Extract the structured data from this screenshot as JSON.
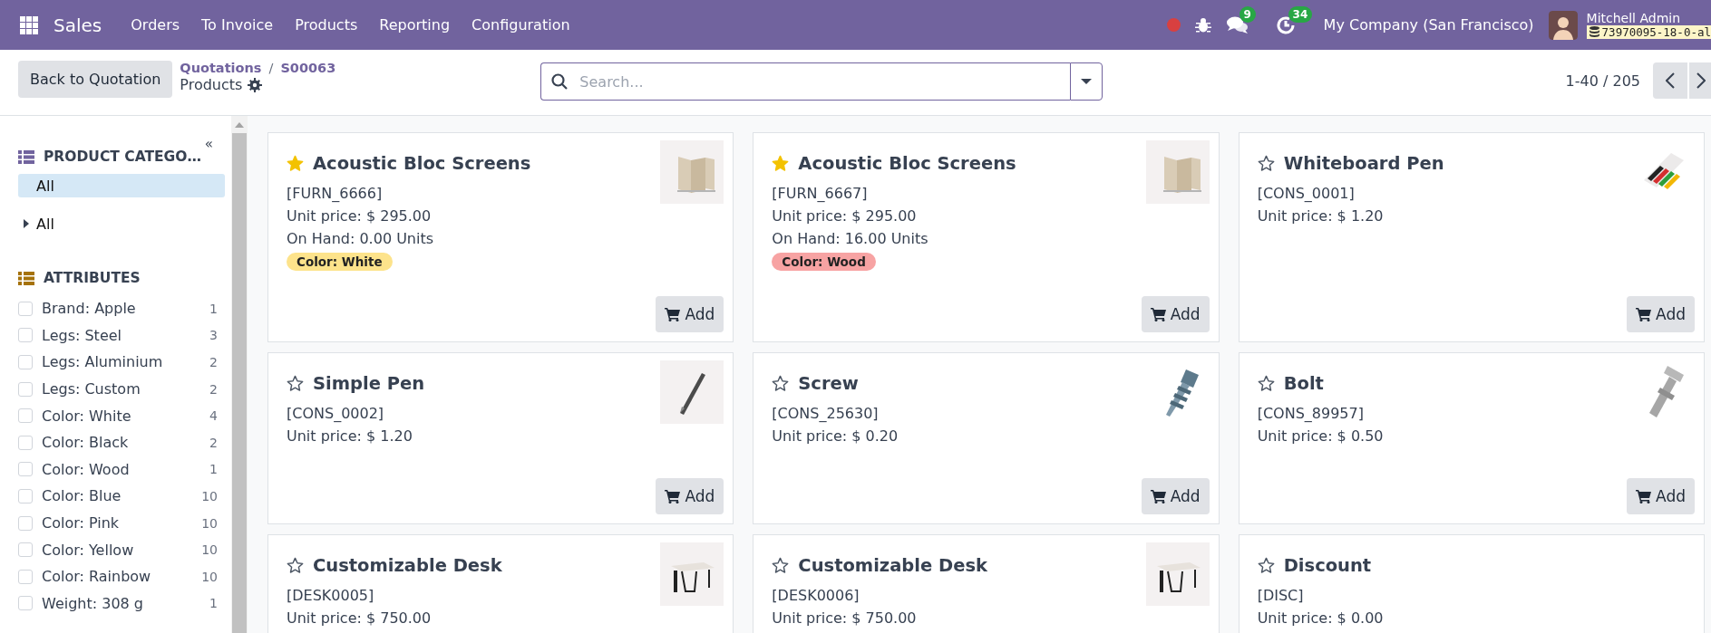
{
  "navbar": {
    "app": "Sales",
    "menu": [
      "Orders",
      "To Invoice",
      "Products",
      "Reporting",
      "Configuration"
    ],
    "chat_count": "9",
    "activity_count": "34",
    "company": "My Company (San Francisco)",
    "user": "Mitchell Admin",
    "database": "73970095-18-0-al"
  },
  "control_panel": {
    "back_button": "Back to Quotation",
    "breadcrumbs": [
      "Quotations",
      "S00063"
    ],
    "breadcrumb_separator": "/",
    "current": "Products",
    "search": {
      "placeholder": "Search..."
    },
    "pager": "1-40 / 205"
  },
  "sidebar": {
    "categories_title": "PRODUCT CATEGO…",
    "collapse": "«",
    "categories": [
      {
        "label": "All",
        "selected": true
      },
      {
        "label": "All",
        "selected": false,
        "expanded": false
      }
    ],
    "attributes_title": "ATTRIBUTES",
    "attributes": [
      {
        "label": "Brand: Apple",
        "count": "1",
        "checked": false
      },
      {
        "label": "Legs: Steel",
        "count": "3",
        "checked": false
      },
      {
        "label": "Legs: Aluminium",
        "count": "2",
        "checked": false
      },
      {
        "label": "Legs: Custom",
        "count": "2",
        "checked": false
      },
      {
        "label": "Color: White",
        "count": "4",
        "checked": false
      },
      {
        "label": "Color: Black",
        "count": "2",
        "checked": false
      },
      {
        "label": "Color: Wood",
        "count": "1",
        "checked": false
      },
      {
        "label": "Color: Blue",
        "count": "10",
        "checked": false
      },
      {
        "label": "Color: Pink",
        "count": "10",
        "checked": false
      },
      {
        "label": "Color: Yellow",
        "count": "10",
        "checked": false
      },
      {
        "label": "Color: Rainbow",
        "count": "10",
        "checked": false
      },
      {
        "label": "Weight: 308 g",
        "count": "1",
        "checked": false
      }
    ]
  },
  "products": [
    {
      "name": "Acoustic Bloc Screens",
      "favorite": true,
      "code": "[FURN_6666]",
      "price": "Unit price: $ 295.00",
      "on_hand": "On Hand: 0.00 Units",
      "tag": {
        "label": "Color: White",
        "color": "#fde38b"
      },
      "button": "Add"
    },
    {
      "name": "Acoustic Bloc Screens",
      "favorite": true,
      "code": "[FURN_6667]",
      "price": "Unit price: $ 295.00",
      "on_hand": "On Hand: 16.00 Units",
      "tag": {
        "label": "Color: Wood",
        "color": "#f7a3a3"
      },
      "button": "Add"
    },
    {
      "name": "Whiteboard Pen",
      "favorite": false,
      "code": "[CONS_0001]",
      "price": "Unit price: $ 1.20",
      "button": "Add"
    },
    {
      "name": "Simple Pen",
      "favorite": false,
      "code": "[CONS_0002]",
      "price": "Unit price: $ 1.20",
      "button": "Add"
    },
    {
      "name": "Screw",
      "favorite": false,
      "code": "[CONS_25630]",
      "price": "Unit price: $ 0.20",
      "button": "Add"
    },
    {
      "name": "Bolt",
      "favorite": false,
      "code": "[CONS_89957]",
      "price": "Unit price: $ 0.50",
      "button": "Add"
    },
    {
      "name": "Customizable Desk",
      "favorite": false,
      "code": "[DESK0005]",
      "price": "Unit price: $ 750.00"
    },
    {
      "name": "Customizable Desk",
      "favorite": false,
      "code": "[DESK0006]",
      "price": "Unit price: $ 750.00"
    },
    {
      "name": "Discount",
      "favorite": false,
      "code": "[DISC]",
      "price": "Unit price: $ 0.00"
    }
  ]
}
